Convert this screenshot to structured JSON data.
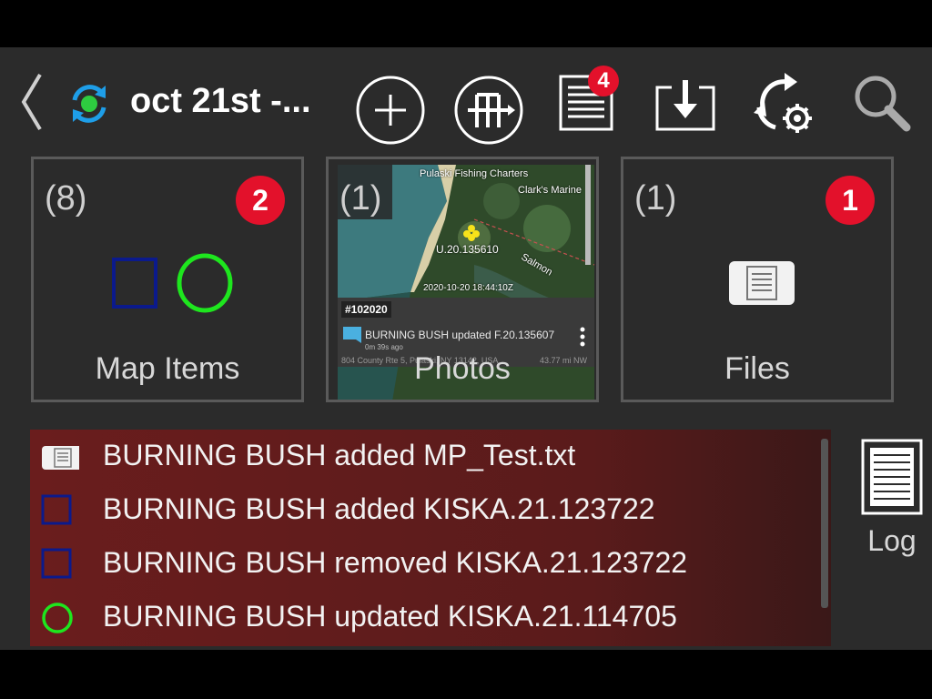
{
  "header": {
    "title": "oct 21st -..."
  },
  "toolbar": {
    "tasks_badge": "4",
    "back_icon": "chevron-left-icon",
    "sync_icon": "sync-icon",
    "add_icon": "plus-icon",
    "tree_icon": "hierarchy-icon",
    "tasks_icon": "document-list-icon",
    "download_icon": "download-icon",
    "settings_icon": "sync-settings-icon",
    "search_icon": "search-icon"
  },
  "tiles": [
    {
      "count": "(8)",
      "label": "Map Items",
      "badge": "2"
    },
    {
      "count": "(1)",
      "label": "Photos",
      "badge": ""
    },
    {
      "count": "(1)",
      "label": "Files",
      "badge": "1"
    }
  ],
  "photo_preview": {
    "place_label": "Pulaski Fishing Charters",
    "place_label_2": "Clark's Marine",
    "marker_label": "U.20.135610",
    "river_label": "Salmon",
    "timestamp": "2020-10-20 18:44:10Z",
    "tag": "#102020",
    "line": "BURNING BUSH updated F.20.135607",
    "sub": "0m 39s ago",
    "address": "804 County Rte 5, Pulaski, NY 13142, USA",
    "distance": "43.77 mi NW"
  },
  "log": {
    "button_label": "Log",
    "items": [
      {
        "icon": "file-icon",
        "text": "BURNING BUSH added MP_Test.txt"
      },
      {
        "icon": "square-icon",
        "text": "BURNING BUSH added KISKA.21.123722"
      },
      {
        "icon": "square-icon",
        "text": "BURNING BUSH removed KISKA.21.123722"
      },
      {
        "icon": "circle-icon",
        "text": "BURNING BUSH updated KISKA.21.114705"
      }
    ]
  },
  "colors": {
    "background": "#2b2b2b",
    "badge": "#e3112b",
    "log_bg": "#6a1d1d",
    "square_blue": "#0b1a8c",
    "circle_green": "#1ee61e",
    "sync_blue": "#1e9ee8",
    "sync_green": "#2ecc40"
  }
}
